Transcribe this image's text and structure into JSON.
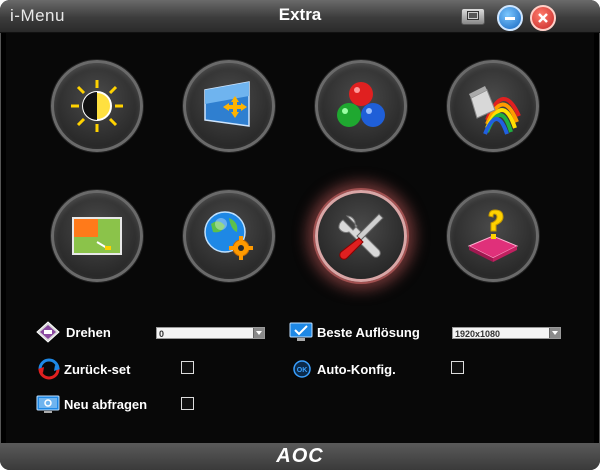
{
  "window": {
    "brand": "i-Menu",
    "title": "Extra"
  },
  "titlebar_buttons": [
    "screen-settings",
    "minimize",
    "close"
  ],
  "categories": [
    {
      "name": "luminance",
      "icon": "brightness-icon"
    },
    {
      "name": "image-setup",
      "icon": "image-setup-icon"
    },
    {
      "name": "color-setup",
      "icon": "color-setup-icon"
    },
    {
      "name": "picture-boost",
      "icon": "picture-boost-icon"
    },
    {
      "name": "osd-setup",
      "icon": "osd-setup-icon"
    },
    {
      "name": "extra-settings",
      "icon": "globe-gear-icon"
    },
    {
      "name": "extra",
      "icon": "tools-icon",
      "active": true
    },
    {
      "name": "exit",
      "icon": "exit-icon"
    }
  ],
  "options": {
    "drehen": {
      "label": "Drehen",
      "value": "0"
    },
    "beste_aufloesung": {
      "label": "Beste Auflösung",
      "value": "1920x1080"
    },
    "zurueck_set": {
      "label": "Zurück-set"
    },
    "auto_konfig": {
      "label": "Auto-Konfig."
    },
    "neu_abfragen": {
      "label": "Neu abfragen"
    }
  },
  "footer": {
    "logo": "AOC"
  }
}
